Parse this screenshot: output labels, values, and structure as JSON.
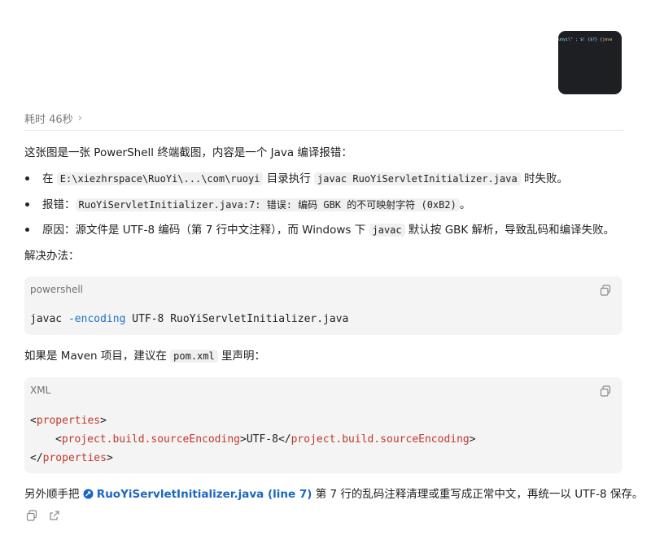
{
  "thumbnail": {
    "preview_text_a": "uoyi\\\" ; $! {$?} {",
    "preview_text_b": "java"
  },
  "elapsed": {
    "label": "耗时 46秒",
    "chevron": "›"
  },
  "intro": "这张图是一张 PowerShell 终端截图，内容是一个 Java 编译报错：",
  "bullets": [
    {
      "t1": "在 ",
      "c1": "E:\\xiezhrspace\\RuoYi\\...\\com\\ruoyi",
      "t2": " 目录执行 ",
      "c2": "javac RuoYiServletInitializer.java",
      "t3": " 时失败。"
    },
    {
      "t1": "报错：",
      "c1": "RuoYiServletInitializer.java:7: 错误: 编码 GBK 的不可映射字符 (0xB2)",
      "t2": "。"
    },
    {
      "t1": "原因：源文件是 UTF-8 编码（第 7 行中文注释），而 Windows 下 ",
      "c1": "javac",
      "t2": " 默认按 GBK 解析，导致乱码和编译失败。"
    }
  ],
  "solution_heading": "解决办法：",
  "code1": {
    "lang": "powershell",
    "cmd": "javac",
    "flag": "-encoding",
    "rest": " UTF-8 RuoYiServletInitializer.java"
  },
  "maven": {
    "t1": "如果是 Maven 项目，建议在 ",
    "c1": "pom.xml",
    "t2": " 里声明："
  },
  "code2": {
    "lang": "XML",
    "outer_tag": "properties",
    "inner_tag": "project.build.sourceEncoding",
    "inner_value": "UTF-8"
  },
  "closing": {
    "t1": "另外顺手把 ",
    "link": "RuoYiServletInitializer.java (line 7)",
    "t2": " 第 7 行的乱码注释清理或重写成正常中文，再统一以 UTF-8 保存。"
  },
  "icons": {
    "copy": "copy-icon",
    "share": "share-icon",
    "link_file": "file-link-icon"
  }
}
